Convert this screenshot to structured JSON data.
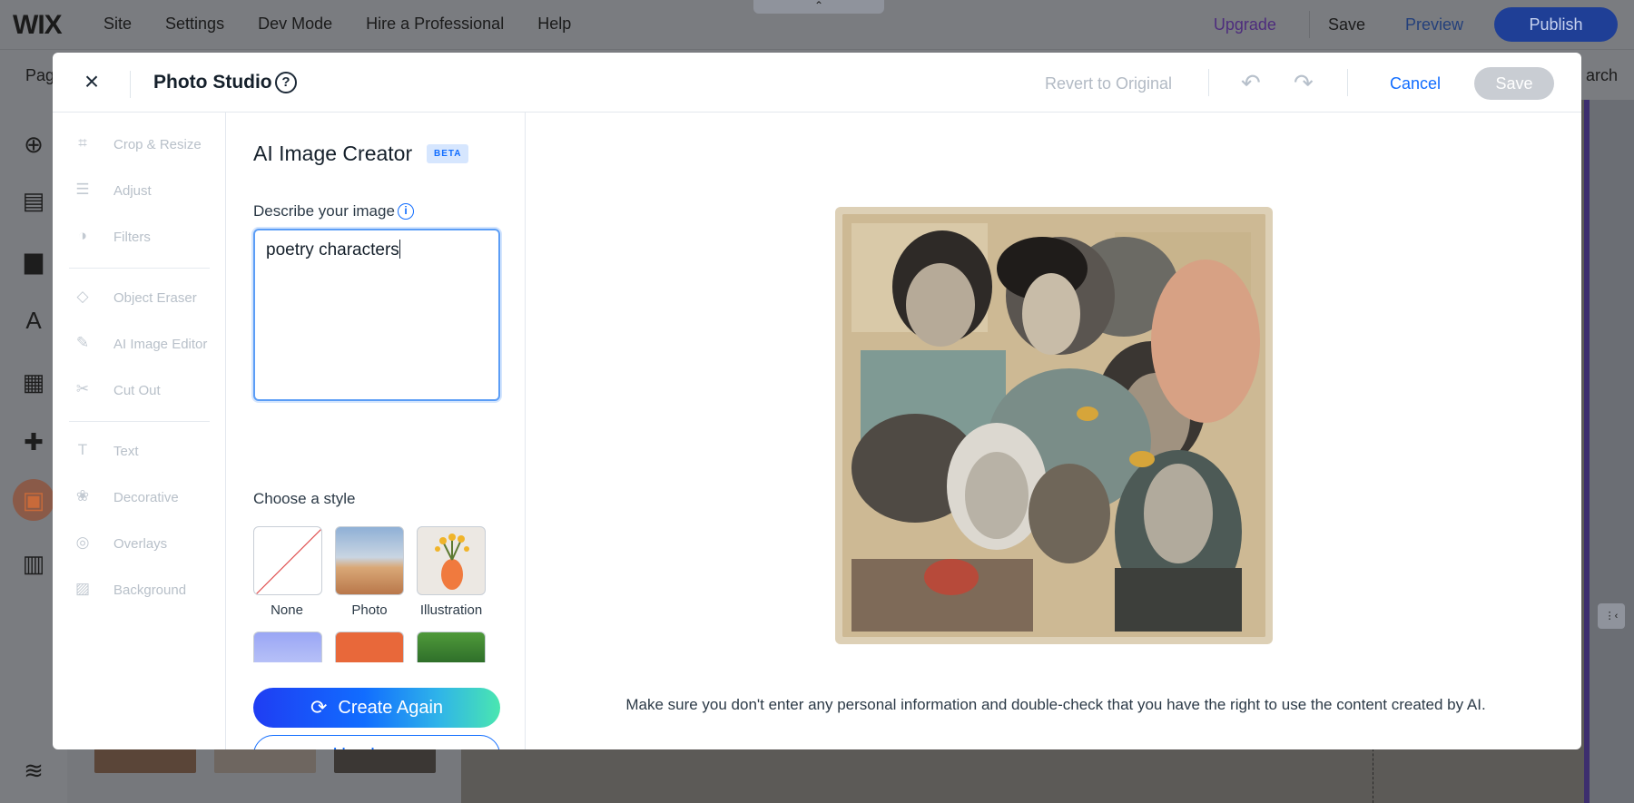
{
  "editor": {
    "logo": "WIX",
    "nav": [
      "Site",
      "Settings",
      "Dev Mode",
      "Hire a Professional",
      "Help"
    ],
    "upgrade": "Upgrade",
    "save": "Save",
    "preview": "Preview",
    "publish": "Publish",
    "pages_partial": "Pag",
    "search_partial": "arch",
    "handle_glyph": "⌃",
    "canvas_handle_glyph": "⋮‹"
  },
  "modal": {
    "title": "Photo Studio",
    "help_glyph": "?",
    "close_glyph": "×",
    "revert": "Revert to Original",
    "undo_glyph": "↶",
    "redo_glyph": "↷",
    "cancel": "Cancel",
    "save": "Save"
  },
  "tools": [
    {
      "label": "Crop & Resize",
      "icon": "crop-icon",
      "glyph": "⌗"
    },
    {
      "label": "Adjust",
      "icon": "sliders-icon",
      "glyph": "☰"
    },
    {
      "label": "Filters",
      "icon": "filters-icon",
      "glyph": "◑"
    },
    {
      "label": "Object Eraser",
      "icon": "eraser-icon",
      "glyph": "◇"
    },
    {
      "label": "AI Image Editor",
      "icon": "ai-edit-icon",
      "glyph": "✎"
    },
    {
      "label": "Cut Out",
      "icon": "scissors-icon",
      "glyph": "✂"
    },
    {
      "label": "Text",
      "icon": "text-icon",
      "glyph": "T"
    },
    {
      "label": "Decorative",
      "icon": "decorative-icon",
      "glyph": "❀"
    },
    {
      "label": "Overlays",
      "icon": "overlays-icon",
      "glyph": "◎"
    },
    {
      "label": "Background",
      "icon": "background-icon",
      "glyph": "▨"
    }
  ],
  "ai_panel": {
    "title": "AI Image Creator",
    "badge": "BETA",
    "describe_label": "Describe your image",
    "info_glyph": "i",
    "prompt_value": "poetry characters",
    "style_label": "Choose a style",
    "styles": [
      {
        "name": "None",
        "selected": false
      },
      {
        "name": "Photo",
        "selected": false
      },
      {
        "name": "Illustration",
        "selected": true
      }
    ],
    "create_again": "Create Again",
    "create_glyph": "⟳",
    "use_image": "Use Image"
  },
  "preview": {
    "disclaimer": "Make sure you don't enter any personal information and double-check that you have the right to use the content created by AI."
  },
  "colors": {
    "accent": "#116dff",
    "publish": "#1f3f96",
    "upgrade": "#4e2d7d"
  }
}
